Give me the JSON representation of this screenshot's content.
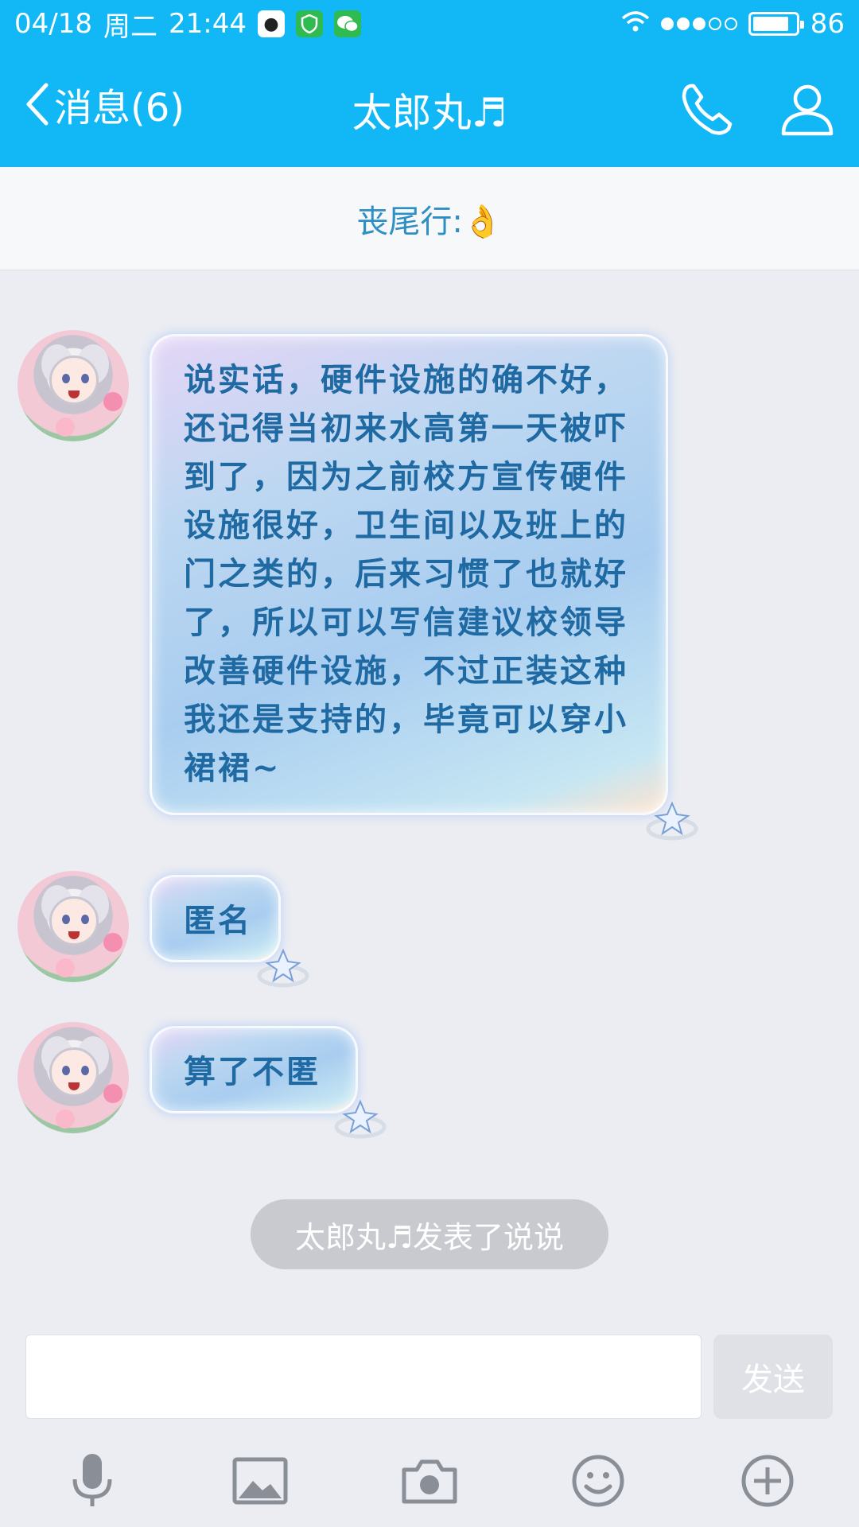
{
  "status_bar": {
    "date": "04/18",
    "weekday": "周二",
    "time": "21:44",
    "battery_percent": "86",
    "battery_level": 0.86,
    "app_icons": [
      "qq-icon",
      "shield-icon",
      "wechat-icon"
    ]
  },
  "nav": {
    "back_label": "消息(6)",
    "title": "太郎丸♬",
    "icons": [
      "chevron-left-icon",
      "phone-icon",
      "profile-icon"
    ]
  },
  "tail": {
    "label": "丧尾行:👌"
  },
  "messages": [
    {
      "sender": "太郎丸♬",
      "text": "说实话，硬件设施的确不好，还记得当初来水高第一天被吓到了，因为之前校方宣传硬件设施很好，卫生间以及班上的门之类的，后来习惯了也就好了，所以可以写信建议校领导改善硬件设施，不过正装这种我还是支持的，毕竟可以穿小裙裙~"
    },
    {
      "sender": "太郎丸♬",
      "text": "匿名"
    },
    {
      "sender": "太郎丸♬",
      "text": "算了不匿"
    }
  ],
  "system_notice": "太郎丸♬发表了说说",
  "composer": {
    "value": "",
    "send_label": "发送",
    "tools": [
      "microphone-icon",
      "image-icon",
      "camera-icon",
      "emoji-icon",
      "plus-icon"
    ]
  },
  "colors": {
    "header_blue": "#12b7f5",
    "bubble_text": "#1f6aa3",
    "tail_text": "#2e8fc4",
    "background": "#ebedf2"
  }
}
